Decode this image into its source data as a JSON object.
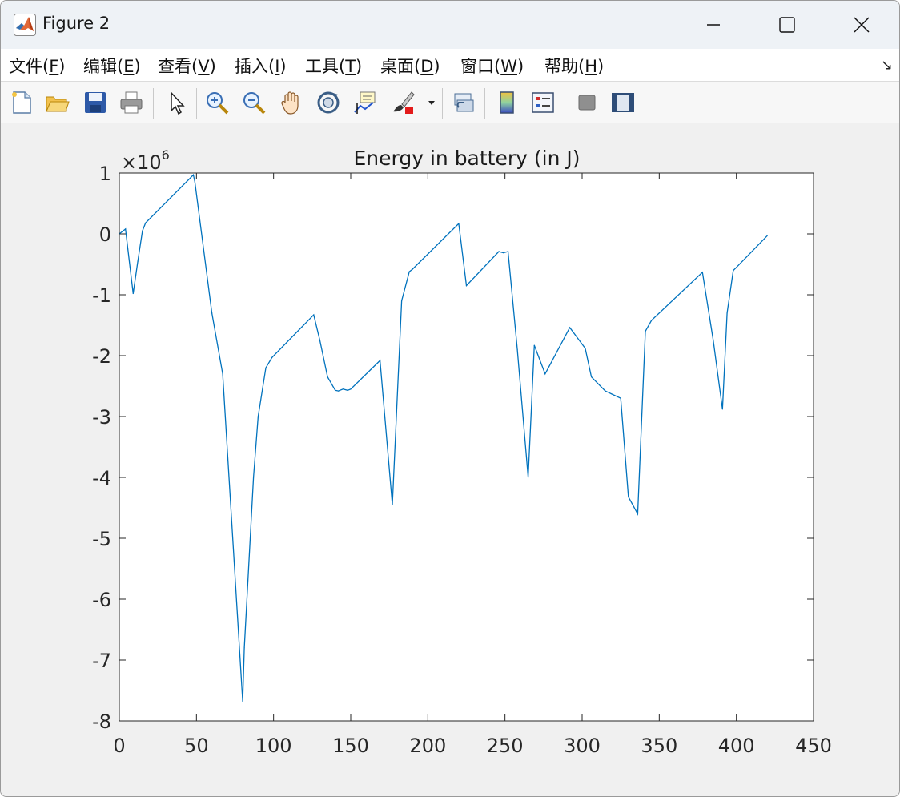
{
  "window": {
    "title": "Figure 2",
    "controls": [
      "minimize",
      "maximize",
      "close"
    ]
  },
  "menu": {
    "items": [
      {
        "label": "文件",
        "key": "F"
      },
      {
        "label": "编辑",
        "key": "E"
      },
      {
        "label": "查看",
        "key": "V"
      },
      {
        "label": "插入",
        "key": "I"
      },
      {
        "label": "工具",
        "key": "T"
      },
      {
        "label": "桌面",
        "key": "D"
      },
      {
        "label": "窗口",
        "key": "W"
      },
      {
        "label": "帮助",
        "key": "H"
      }
    ],
    "dock_arrow": "↘"
  },
  "toolbar": {
    "tools": [
      "new-figure-icon",
      "open-file-icon",
      "save-icon",
      "print-icon",
      "edit-plot-arrow-icon",
      "zoom-in-icon",
      "zoom-out-icon",
      "pan-hand-icon",
      "rotate-3d-icon",
      "data-cursor-icon",
      "brush-icon",
      "link-plot-icon",
      "colorbar-icon",
      "legend-icon",
      "hide-plot-tools-icon",
      "show-plot-tools-icon"
    ]
  },
  "chart_data": {
    "type": "line",
    "title": "Energy in battery (in J)",
    "xlabel": "",
    "ylabel": "",
    "y_multiplier": "×10^6",
    "xlim": [
      0,
      450
    ],
    "ylim": [
      -8,
      1
    ],
    "xticks": [
      0,
      50,
      100,
      150,
      200,
      250,
      300,
      350,
      400,
      450
    ],
    "yticks": [
      1,
      0,
      -1,
      -2,
      -3,
      -4,
      -5,
      -6,
      -7,
      -8
    ],
    "grid": false,
    "line_color": "#0072bd",
    "series": [
      {
        "x": [
          0,
          4,
          9,
          12,
          15,
          17,
          48,
          49,
          60,
          67,
          80,
          81,
          87,
          90,
          95,
          99,
          126,
          130,
          135,
          140,
          142,
          145,
          148,
          150,
          169,
          177,
          183,
          188,
          190,
          220,
          225,
          246,
          249,
          252,
          258,
          265,
          269,
          276,
          292,
          302,
          306,
          315,
          325,
          330,
          336,
          341,
          345,
          378,
          385,
          391,
          394,
          398,
          400,
          420
        ],
        "y": [
          0.0,
          0.08,
          -0.98,
          -0.45,
          0.05,
          0.18,
          0.97,
          0.85,
          -1.3,
          -2.3,
          -7.68,
          -6.8,
          -4.0,
          -3.0,
          -2.2,
          -2.03,
          -1.33,
          -1.75,
          -2.35,
          -2.57,
          -2.58,
          -2.55,
          -2.57,
          -2.55,
          -2.08,
          -4.45,
          -1.1,
          -0.62,
          -0.58,
          0.17,
          -0.85,
          -0.29,
          -0.31,
          -0.29,
          -1.9,
          -4.0,
          -1.83,
          -2.3,
          -1.54,
          -1.88,
          -2.35,
          -2.58,
          -2.7,
          -4.32,
          -4.6,
          -1.6,
          -1.42,
          -0.63,
          -1.75,
          -2.88,
          -1.3,
          -0.6,
          -0.55,
          -0.03
        ]
      }
    ]
  }
}
